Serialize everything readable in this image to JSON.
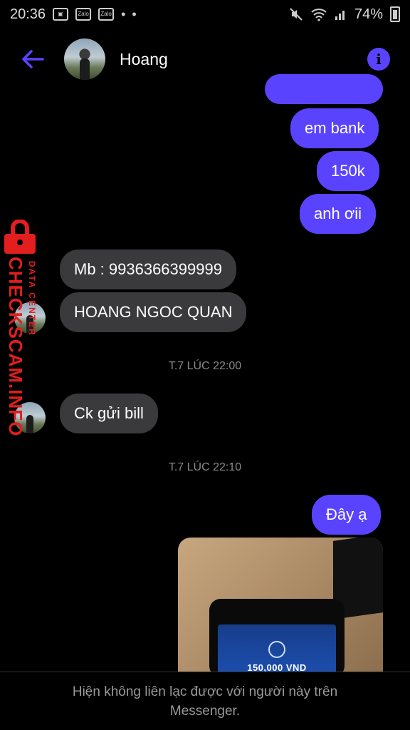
{
  "status_bar": {
    "time": "20:36",
    "notif_icons": [
      "gallery-icon",
      "zalo-icon",
      "zalo-icon"
    ],
    "zalo_label": "Zalo",
    "more": "• •",
    "battery": "74%"
  },
  "header": {
    "name": "Hoang",
    "accent_color": "#5a43ff"
  },
  "messages": {
    "out_1": "em bank",
    "out_2": "150k",
    "out_3": "anh ơii",
    "in_1": "Mb : 9936366399999",
    "in_2": "HOANG NGOC QUAN",
    "time_1": "T.7 LÚC 22:00",
    "in_3": "Ck gửi bill",
    "time_2": "T.7 LÚC 22:10",
    "out_4": "Đây ạ",
    "photo_amount": "150,000 VND"
  },
  "watermark": {
    "main": "CHECKSCAM.INFO",
    "sub": "DATA CENTER"
  },
  "footer": {
    "notice": "Hiện không liên lạc được với người này trên Messenger."
  }
}
